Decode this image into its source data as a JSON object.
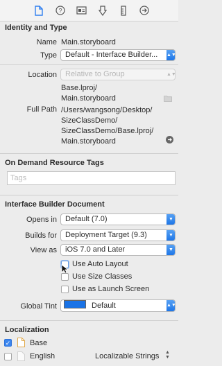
{
  "toolbar": {
    "icons": [
      "file-icon",
      "help-icon",
      "identity-icon",
      "attributes-icon",
      "size-ruler-icon",
      "connections-icon"
    ]
  },
  "identity_type": {
    "title": "Identity and Type",
    "name_label": "Name",
    "name_value": "Main.storyboard",
    "type_label": "Type",
    "type_value": "Default - Interface Builder...",
    "location_label": "Location",
    "location_value": "Relative to Group",
    "location_path_line1": "Base.lproj/",
    "location_path_line2": "Main.storyboard",
    "full_path_label": "Full Path",
    "full_path_lines": [
      "/Users/wangsong/Desktop/",
      "SizeClassDemo/",
      "SizeClassDemo/Base.lproj/",
      "Main.storyboard"
    ]
  },
  "on_demand": {
    "title": "On Demand Resource Tags",
    "tags_placeholder": "Tags"
  },
  "ib_document": {
    "title": "Interface Builder Document",
    "opens_in_label": "Opens in",
    "opens_in_value": "Default (7.0)",
    "builds_for_label": "Builds for",
    "builds_for_value": "Deployment Target (9.3)",
    "view_as_label": "View as",
    "view_as_value": "iOS 7.0 and Later",
    "use_auto_layout": "Use Auto Layout",
    "use_size_classes": "Use Size Classes",
    "use_launch_screen": "Use as Launch Screen",
    "global_tint_label": "Global Tint",
    "global_tint_value": "Default",
    "tint_color": "#1a73e6"
  },
  "localization": {
    "title": "Localization",
    "items": [
      {
        "label": "Base",
        "checked": true
      },
      {
        "label": "English",
        "checked": false,
        "detail": "Localizable Strings"
      }
    ]
  }
}
